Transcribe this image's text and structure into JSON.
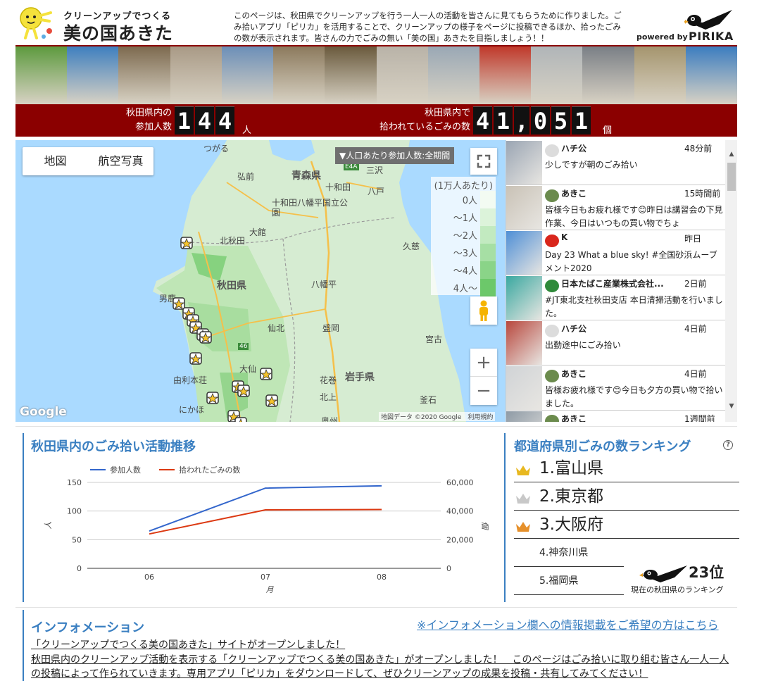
{
  "header": {
    "site_subtitle": "クリーンアップでつくる",
    "site_title": "美の国あきた",
    "intro_text": "このページは、秋田県でクリーンアップを行う一人一人の活動を皆さんに見てもらうために作りました。ごみ拾いアプリ「ピリカ」を活用することで、クリーンアップの様子をページに投稿できるほか、拾ったごみの数が表示されます。皆さんの力でごみの無い「美の国」あきたを目指しましょう！！",
    "powered_by": "powered by",
    "brand": "PIRIKA"
  },
  "photos": [
    "#5d9a3e",
    "#3f7fbf",
    "#7d6a4f",
    "#a99a86",
    "#6c8fb8",
    "#8c7a5d",
    "#6a5a3d",
    "#b9b3a8",
    "#9aa8b5",
    "#c0392b",
    "#b0b5b8",
    "#7a7f86",
    "#a5956e",
    "#3c7dc0"
  ],
  "counters": {
    "participants_label_1": "秋田県内の",
    "participants_label_2": "参加人数",
    "participants_value": "144",
    "participants_unit": "人",
    "trash_label_1": "秋田県内で",
    "trash_label_2": "拾われているごみの数",
    "trash_value": "41,051",
    "trash_unit": "個"
  },
  "map": {
    "type_tabs": [
      "地図",
      "航空写真"
    ],
    "legend_dropdown": "▼人口あたり参加人数:全期間",
    "legend_title": "(1万人あたり)",
    "legend_rows": [
      {
        "label": "0人",
        "color": "#f3fbf2"
      },
      {
        "label": "～1人",
        "color": "#dcf3da"
      },
      {
        "label": "～2人",
        "color": "#c2eac0"
      },
      {
        "label": "～3人",
        "color": "#a6dfa4"
      },
      {
        "label": "～4人",
        "color": "#8ad488"
      },
      {
        "label": "4人～",
        "color": "#6cc86a"
      }
    ],
    "zoom_in": "+",
    "zoom_out": "−",
    "google": "Google",
    "attribution": "地図データ ©2020 Google　利用規約",
    "places": {
      "tsugaru": "つがる",
      "hirosaki": "弘前",
      "aomori": "青森県",
      "misawa": "三沢",
      "towada": "十和田",
      "hachinohe": "八戸",
      "towada_park": "十和田八幡平国立公園",
      "odate": "大館",
      "kitaakita": "北秋田",
      "kuji": "久慈",
      "akita": "秋田県",
      "hachimantai": "八幡平",
      "oga": "男鹿",
      "semboku": "仙北",
      "morioka": "盛岡",
      "miyako": "宮古",
      "daisen": "大仙",
      "yurihonjo": "由利本荘",
      "hanamaki": "花巻",
      "iwate": "岩手県",
      "kitakami": "北上",
      "nikaho": "にかほ",
      "kamaishi": "釜石",
      "oshu": "奥州",
      "e4a": "E4A",
      "r46": "46"
    }
  },
  "feed": [
    {
      "user": "ハチ公",
      "time": "48分前",
      "text": "少しですが朝のごみ拾い",
      "thumb": "#9aa5b3",
      "avatar": "#dcdcdc"
    },
    {
      "user": "あきこ",
      "time": "15時間前",
      "text": "皆様今日もお疲れ様です😊昨日は講習会の下見作業、今日はいつもの買い物でちょ",
      "thumb": "#c9c2b6",
      "avatar": "#6b8b4d"
    },
    {
      "user": "K",
      "time": "昨日",
      "text": "Day 23 What a blue sky! #全国砂浜ムーブメント2020",
      "thumb": "#4f8fd6",
      "avatar": "#d9261c"
    },
    {
      "user": "日本たばこ産業株式会社...",
      "time": "2日前",
      "text": "#JT東北支社秋田支店 本日清掃活動を行いました。",
      "thumb": "#3aa8a0",
      "avatar": "#2f8a3a"
    },
    {
      "user": "ハチ公",
      "time": "4日前",
      "text": "出勤途中にごみ拾い",
      "thumb": "#b8473d",
      "avatar": "#dcdcdc"
    },
    {
      "user": "あきこ",
      "time": "4日前",
      "text": "皆様お疲れ様です😊今日も夕方の買い物で拾いました。",
      "thumb": "#d0d3d6",
      "avatar": "#6b8b4d"
    },
    {
      "user": "あきこ",
      "time": "1週間前",
      "text": "",
      "thumb": "#8e9aa5",
      "avatar": "#6b8b4d"
    }
  ],
  "trend": {
    "title": "秋田県内のごみ拾い活動推移",
    "left_unit": "人",
    "right_unit": "個",
    "x_label": "月"
  },
  "chart_data": {
    "type": "line",
    "categories": [
      "06",
      "07",
      "08"
    ],
    "series": [
      {
        "name": "参加人数",
        "values": [
          65,
          140,
          144
        ],
        "axis": "left",
        "color": "#3366cc"
      },
      {
        "name": "拾われたごみの数",
        "values": [
          24000,
          40800,
          41051
        ],
        "axis": "right",
        "color": "#dc3912"
      }
    ],
    "xlabel": "月",
    "ylabel_left": "人",
    "ylabel_right": "個",
    "ylim_left": [
      0,
      150
    ],
    "ylim_right": [
      0,
      60000
    ],
    "yticks_left": [
      "0",
      "50",
      "100",
      "150"
    ],
    "yticks_right": [
      "0",
      "20,000",
      "40,000",
      "60,000"
    ],
    "legend": "top-left",
    "grid": true
  },
  "ranking": {
    "title": "都道府県別ごみの数ランキング",
    "help": "?",
    "top": [
      {
        "label": "1.富山県",
        "crown": "#e8b820"
      },
      {
        "label": "2.東京都",
        "crown": "#c8c8c8"
      },
      {
        "label": "3.大阪府",
        "crown": "#e6902a"
      }
    ],
    "rest": [
      "4.神奈川県",
      "5.福岡県"
    ],
    "my_rank": "23位",
    "my_rank_label": "現在の秋田県のランキング"
  },
  "info": {
    "title": "インフォメーション",
    "link": "※インフォメーション欄への情報掲載をご希望の方はこちら",
    "headline": "「クリーンアップでつくる美の国あきた」サイトがオープンしました！",
    "body": "秋田県内のクリーンアップ活動を表示する「クリーンアップでつくる美の国あきた」がオープンしました！　このページはごみ拾いに取り組む皆さん一人一人の投稿によって作られていきます。専用アプリ「ピリカ」をダウンロードして、ぜひクリーンアップの成果を投稿・共有してみてください！"
  }
}
